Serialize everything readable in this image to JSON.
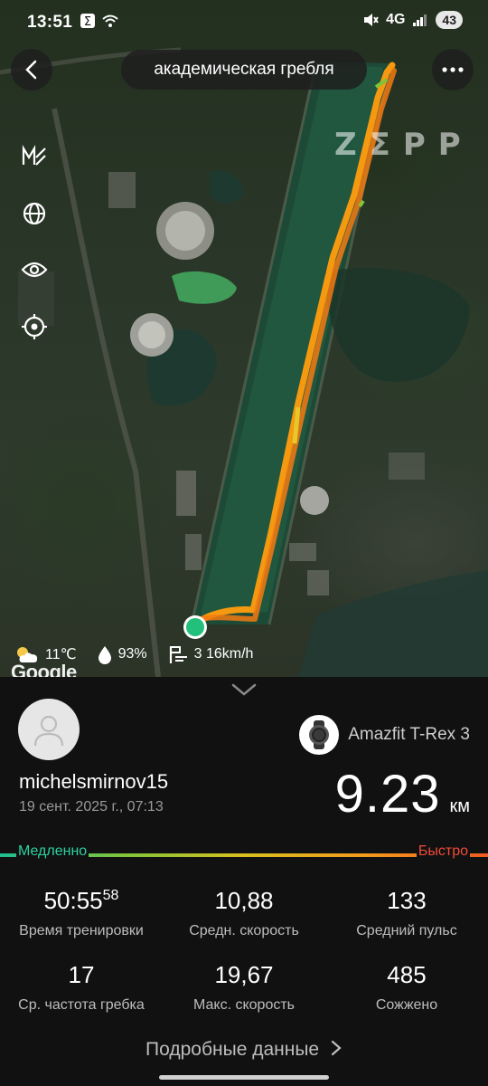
{
  "status_bar": {
    "time": "13:51",
    "network": "4G",
    "battery": "43"
  },
  "header": {
    "title": "академическая гребля",
    "watermark": "ZΣPP"
  },
  "map_tools": [
    "distance-marker-icon",
    "globe-icon",
    "eye-icon",
    "locate-icon"
  ],
  "weather": {
    "temperature": "11℃",
    "humidity": "93%",
    "wind": "3 16km/h"
  },
  "map_attribution": "Google",
  "workout": {
    "user": "michelsmirnov15",
    "date": "19 сент. 2025 г., 07:13",
    "device": "Amazfit T-Rex 3",
    "distance": "9.23",
    "distance_unit": "км"
  },
  "speed_legend": {
    "slow": "Медленно",
    "fast": "Быстро"
  },
  "stats": {
    "duration_main": "50:55",
    "duration_seconds": "58",
    "duration_label": "Время тренировки",
    "avg_speed": "10,88",
    "avg_speed_label": "Средн. скорость",
    "avg_hr": "133",
    "avg_hr_label": "Средний пульс",
    "stroke_rate": "17",
    "stroke_rate_label": "Ср. частота гребка",
    "max_speed": "19,67",
    "max_speed_label": "Макс. скорость",
    "calories": "485",
    "calories_label": "Сожжено"
  },
  "details_link": "Подробные данные",
  "colors": {
    "slow": "#2ed1a0",
    "fast": "#f24a3a",
    "track": "#f5900f"
  }
}
